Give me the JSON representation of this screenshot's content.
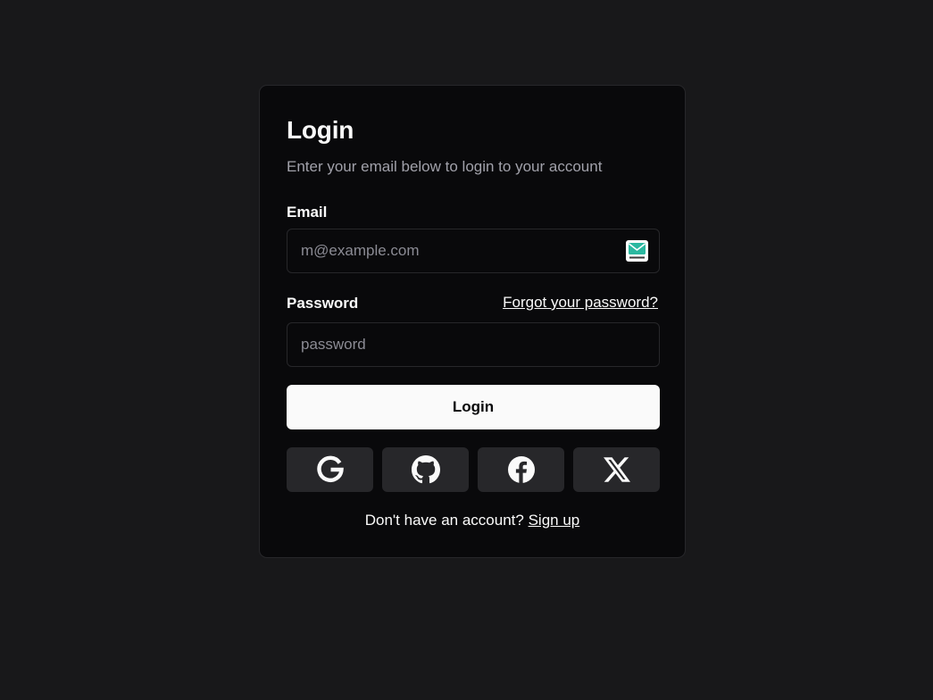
{
  "login_card": {
    "title": "Login",
    "subtitle": "Enter your email below to login to your account",
    "email": {
      "label": "Email",
      "value": "",
      "placeholder": "m@example.com"
    },
    "password": {
      "label": "Password",
      "value": "",
      "placeholder": "password",
      "forgot_link": "Forgot your password?"
    },
    "login_button": "Login",
    "social_buttons": [
      {
        "icon": "google-icon"
      },
      {
        "icon": "github-icon"
      },
      {
        "icon": "facebook-icon"
      },
      {
        "icon": "x-icon"
      }
    ],
    "footer": {
      "prompt": "Don't have an account?",
      "signup_link": "Sign up"
    }
  },
  "colors": {
    "page_background": "#18181a",
    "card_background": "#09090b",
    "border": "#27272a",
    "text_primary": "#fafafa",
    "text_muted": "#a1a1aa",
    "social_button_bg": "#27272a",
    "email_icon_accent": "#2bb8a0"
  }
}
